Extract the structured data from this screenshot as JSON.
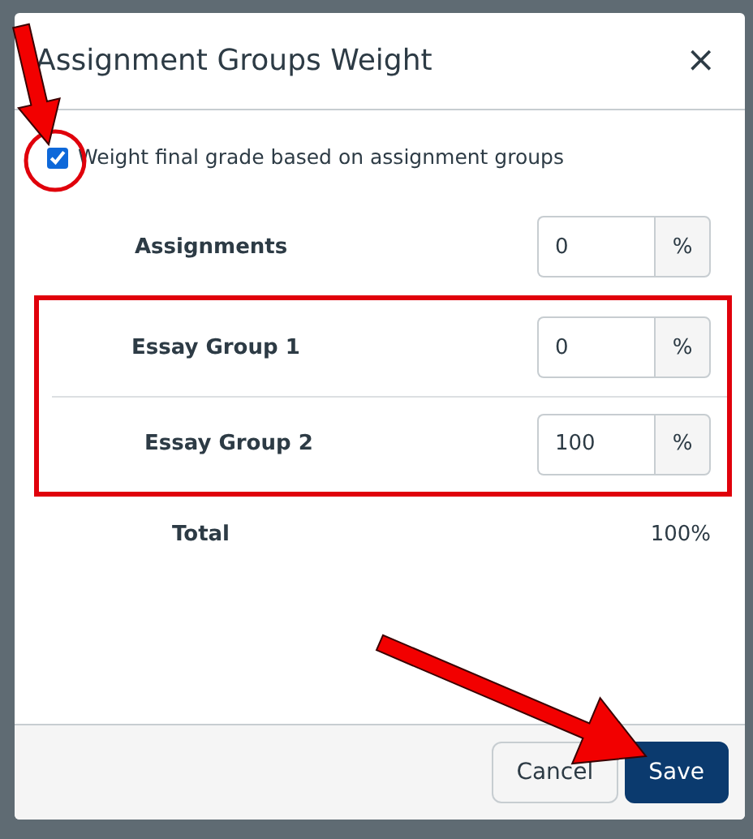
{
  "dialog": {
    "title": "Assignment Groups Weight",
    "close": "×"
  },
  "weight_option": {
    "label": "Weight final grade based on assignment groups",
    "checked": true
  },
  "groups": [
    {
      "name": "Assignments",
      "value": "0",
      "unit": "%",
      "highlighted": false
    },
    {
      "name": "Essay Group 1",
      "value": "0",
      "unit": "%",
      "highlighted": true
    },
    {
      "name": "Essay Group 2",
      "value": "100",
      "unit": "%",
      "highlighted": true
    }
  ],
  "total": {
    "label": "Total",
    "value": "100%"
  },
  "buttons": [
    {
      "label": "Cancel",
      "kind": "secondary"
    },
    {
      "label": "Save",
      "kind": "primary"
    }
  ],
  "annotations": [
    {
      "kind": "circle"
    },
    {
      "kind": "arrow-to-checkbox"
    },
    {
      "kind": "arrow-to-save"
    }
  ]
}
